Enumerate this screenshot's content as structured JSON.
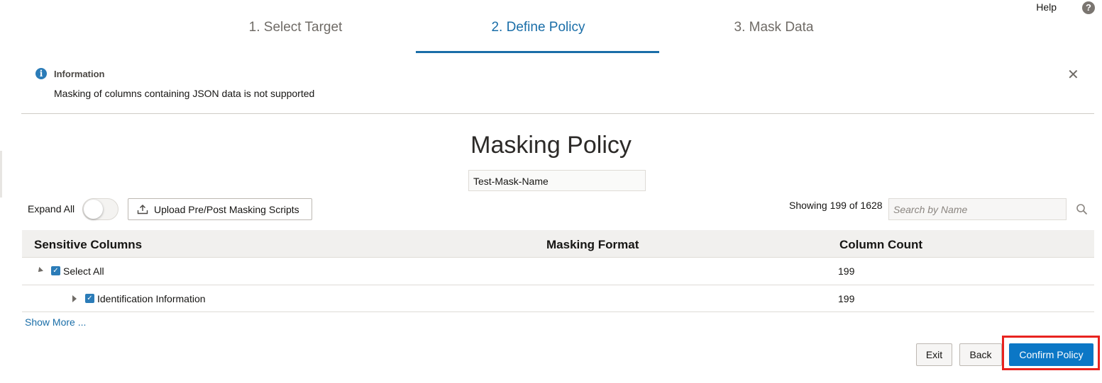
{
  "header": {
    "help_label": "Help",
    "help_icon": "question-circle-icon"
  },
  "steps": [
    {
      "label": "1. Select Target",
      "active": false
    },
    {
      "label": "2. Define Policy",
      "active": true
    },
    {
      "label": "3. Mask Data",
      "active": false
    }
  ],
  "info": {
    "title": "Information",
    "message": "Masking of columns containing JSON data is not supported",
    "icon": "info-icon",
    "close_icon": "close-icon",
    "close_glyph": "✕"
  },
  "policy": {
    "title": "Masking Policy",
    "name_value": "Test-Mask-Name"
  },
  "toolbar": {
    "expand_all_label": "Expand All",
    "expand_all_on": false,
    "upload_label": "Upload Pre/Post Masking Scripts",
    "showing_text": "Showing 199 of 1628",
    "search_placeholder": "Search by Name"
  },
  "table": {
    "headers": [
      "Sensitive Columns",
      "Masking Format",
      "Column Count"
    ],
    "rows": [
      {
        "label": "Select All",
        "masking_format": "",
        "count": "199",
        "checked": true,
        "expanded": true
      },
      {
        "label": "Identification Information",
        "masking_format": "",
        "count": "199",
        "checked": true,
        "expanded": false
      }
    ],
    "show_more": "Show More ..."
  },
  "footer": {
    "exit_label": "Exit",
    "back_label": "Back",
    "confirm_label": "Confirm Policy"
  },
  "colors": {
    "accent": "#1a6ea8",
    "primary_button": "#0b77c6",
    "highlight": "#e8231f"
  }
}
